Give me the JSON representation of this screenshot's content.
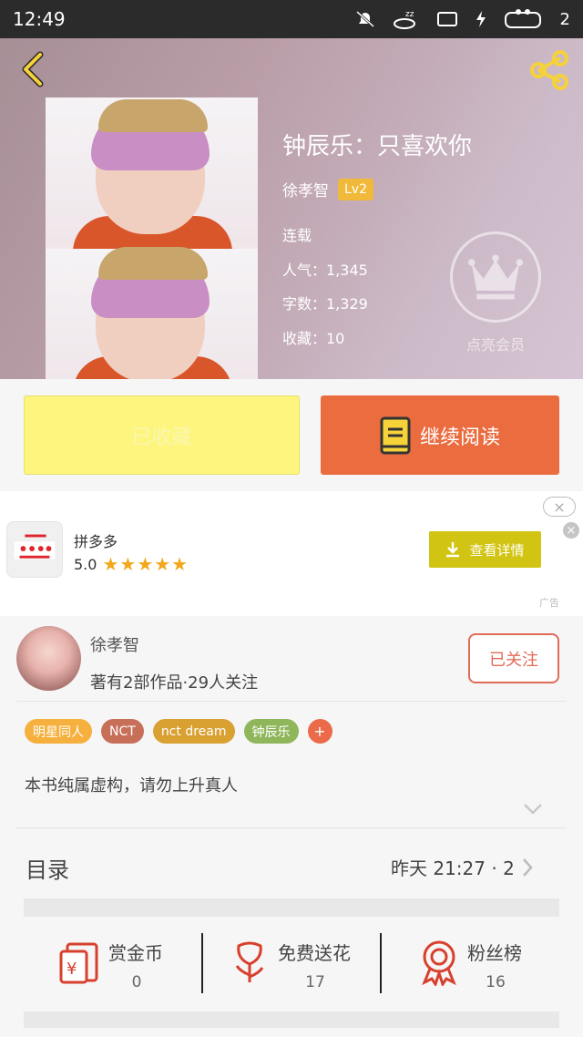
{
  "status_bar": {
    "time": "12:49",
    "battery": "2"
  },
  "book": {
    "title": "钟辰乐：只喜欢你",
    "author": "徐孝智",
    "level": "Lv2",
    "status": "连载",
    "popularity": "人气：1,345",
    "word_count": "字数：1,329",
    "favorites": "收藏：10"
  },
  "vip": {
    "label": "点亮会员"
  },
  "actions": {
    "collected_label": "已收藏",
    "read_label": "继续阅读"
  },
  "ad": {
    "app_name": "拼多多",
    "rating": "5.0",
    "stars": "★★★★★",
    "button_label": "查看详情",
    "ad_tag": "广告",
    "close_symbol": "×"
  },
  "author_card": {
    "name": "徐孝智",
    "summary": "著有2部作品·29人关注",
    "follow_label": "已关注"
  },
  "tags": [
    {
      "label": "明星同人",
      "color": "#f5b03e"
    },
    {
      "label": "NCT",
      "color": "#c86f5a"
    },
    {
      "label": "nct dream",
      "color": "#d9a032"
    },
    {
      "label": "钟辰乐",
      "color": "#8fb65a"
    }
  ],
  "tag_more": "+",
  "intro": "本书纯属虚构，请勿上升真人",
  "toc": {
    "title": "目录",
    "updated": "昨天 21:27 · 2"
  },
  "stats": [
    {
      "label": "赏金币",
      "value": "0",
      "icon": "red-envelope-icon"
    },
    {
      "label": "免费送花",
      "value": "17",
      "icon": "flower-icon"
    },
    {
      "label": "粉丝榜",
      "value": "16",
      "icon": "medal-icon"
    }
  ],
  "colors": {
    "accent": "#eb6c3f",
    "tag_yellow": "#f5b03e",
    "lv_badge": "#f0b93a"
  }
}
